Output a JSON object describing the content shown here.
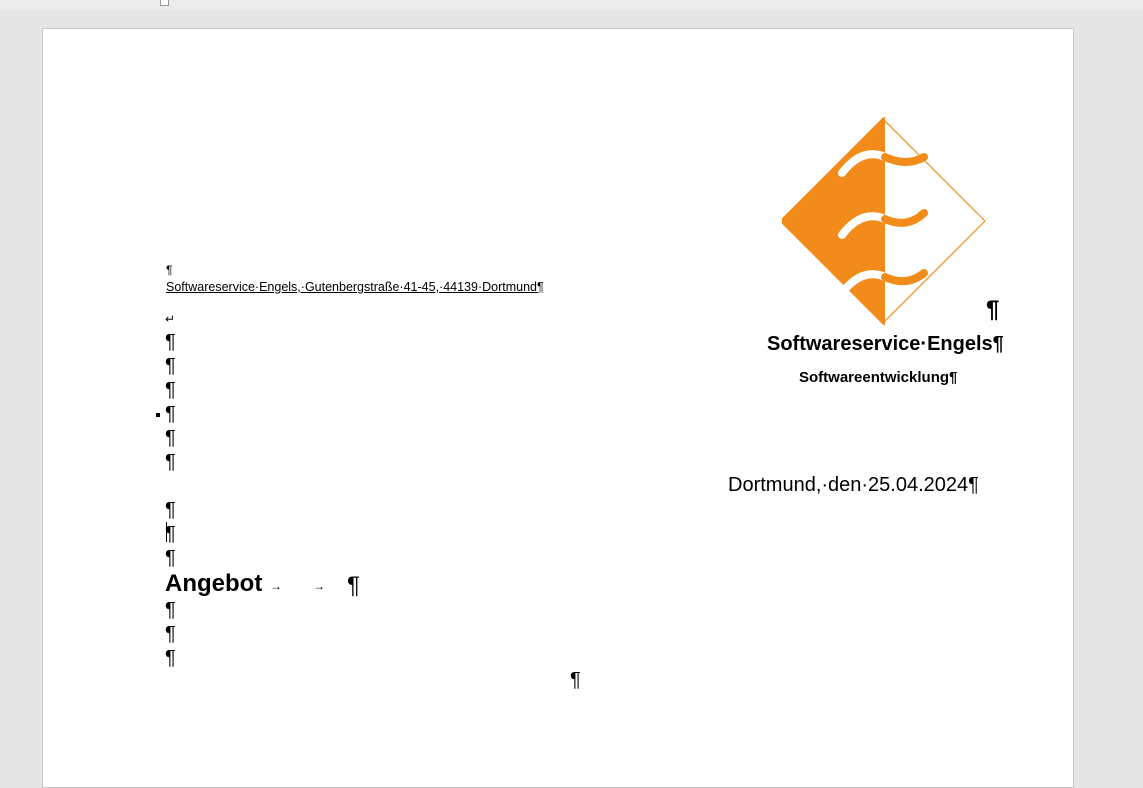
{
  "document": {
    "sender_line": "Softwareservice·Engels,·Gutenbergstraße·41-45,·44139·Dortmund¶",
    "pilcrow": "¶",
    "line_break": "↵",
    "company_name": "Softwareservice·Engels¶",
    "department": "Softwareentwicklung¶",
    "date_line": "Dortmund,·den·25.04.2024¶",
    "title": "Angebot",
    "tab_marker": "→"
  },
  "colors": {
    "logo_orange": "#f28b1a",
    "page_background": "#ffffff",
    "workspace_background": "#e6e6e6"
  },
  "icons": {
    "logo": "softwareservice-engels-logo-icon",
    "anchor": "anchor-marker-icon"
  }
}
